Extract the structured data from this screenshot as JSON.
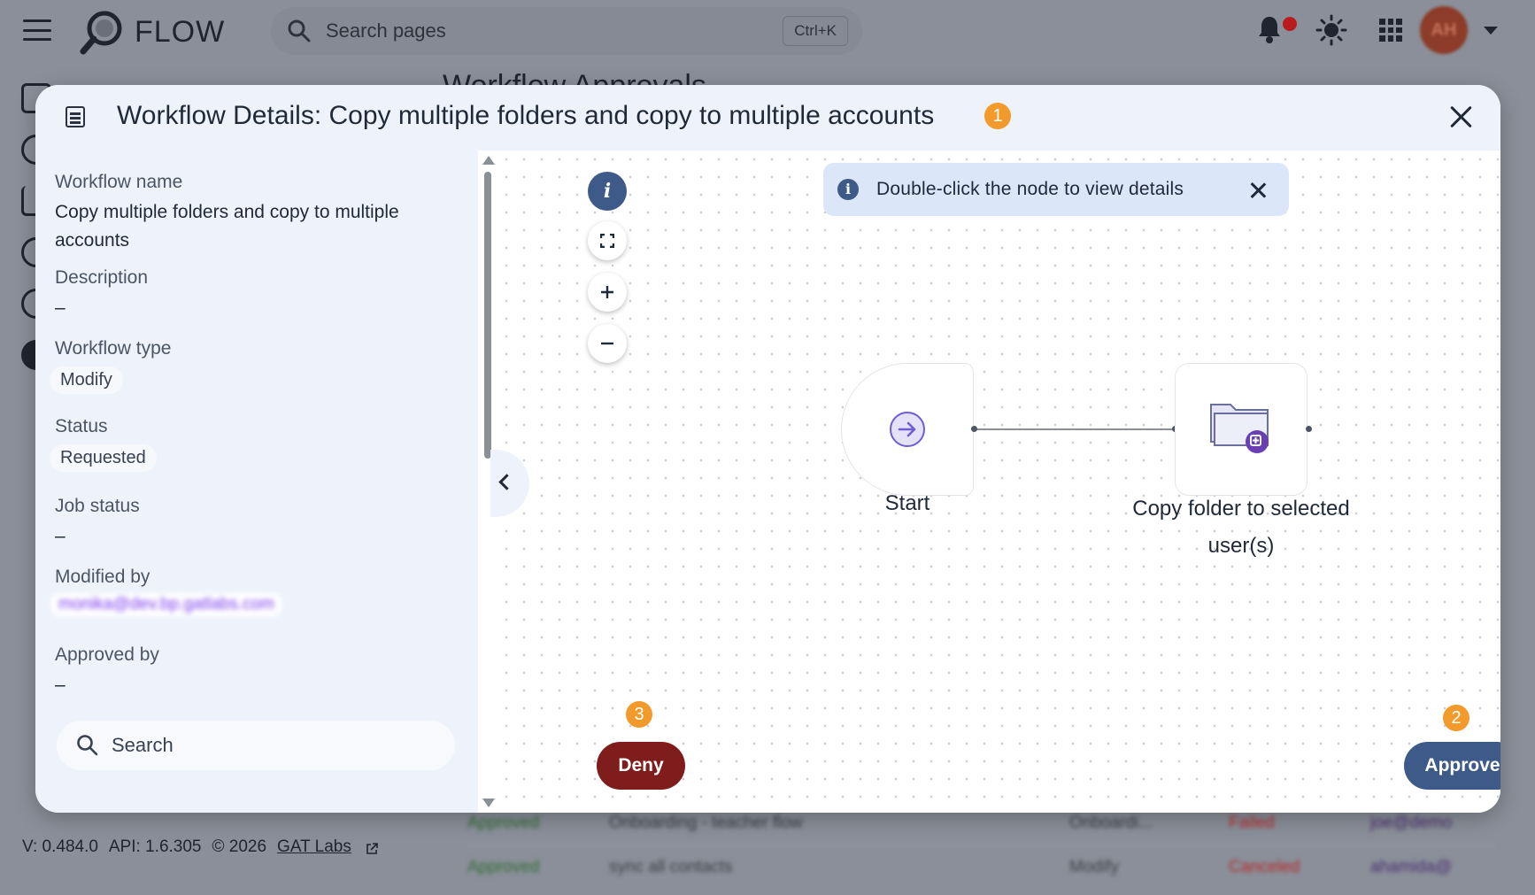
{
  "app": {
    "name": "FLOW",
    "avatar_initials": "AH"
  },
  "search": {
    "placeholder": "Search pages",
    "shortcut": "Ctrl+K"
  },
  "background": {
    "heading": "Workflow Approvals",
    "rows": [
      {
        "status": "Approved",
        "name": "Onboarding - teacher flow",
        "type": "Onboardi...",
        "job": "Failed",
        "user": "joe@demo"
      },
      {
        "status": "Approved",
        "name": "sync all contacts",
        "type": "Modify",
        "job": "Canceled",
        "user": "ahamida@"
      }
    ]
  },
  "footer": {
    "version": "V: 0.484.0",
    "api": "API: 1.6.305",
    "copyright": "© 2026",
    "link": "GAT Labs"
  },
  "modal": {
    "title": "Workflow Details: Copy multiple folders and copy to multiple accounts",
    "badge1": "1",
    "fields": {
      "workflow_name_label": "Workflow name",
      "workflow_name_value": "Copy multiple folders and copy to multiple accounts",
      "description_label": "Description",
      "description_value": "–",
      "workflow_type_label": "Workflow type",
      "workflow_type_value": "Modify",
      "status_label": "Status",
      "status_value": "Requested",
      "job_status_label": "Job status",
      "job_status_value": "–",
      "modified_by_label": "Modified by",
      "modified_by_value": "monika@dev.bp.gatlabs.com",
      "approved_by_label": "Approved by",
      "approved_by_value": "–"
    },
    "panel_search_placeholder": "Search",
    "hint": "Double-click the node to view details",
    "nodes": {
      "start": "Start",
      "copy": "Copy folder to selected user(s)"
    },
    "deny": "Deny",
    "approve": "Approve",
    "badge2": "2",
    "badge3": "3"
  },
  "colors": {
    "primary": "#3e5a88",
    "deny": "#7f1d1d",
    "badge": "#f39a2c",
    "panel": "#eef3fb"
  }
}
